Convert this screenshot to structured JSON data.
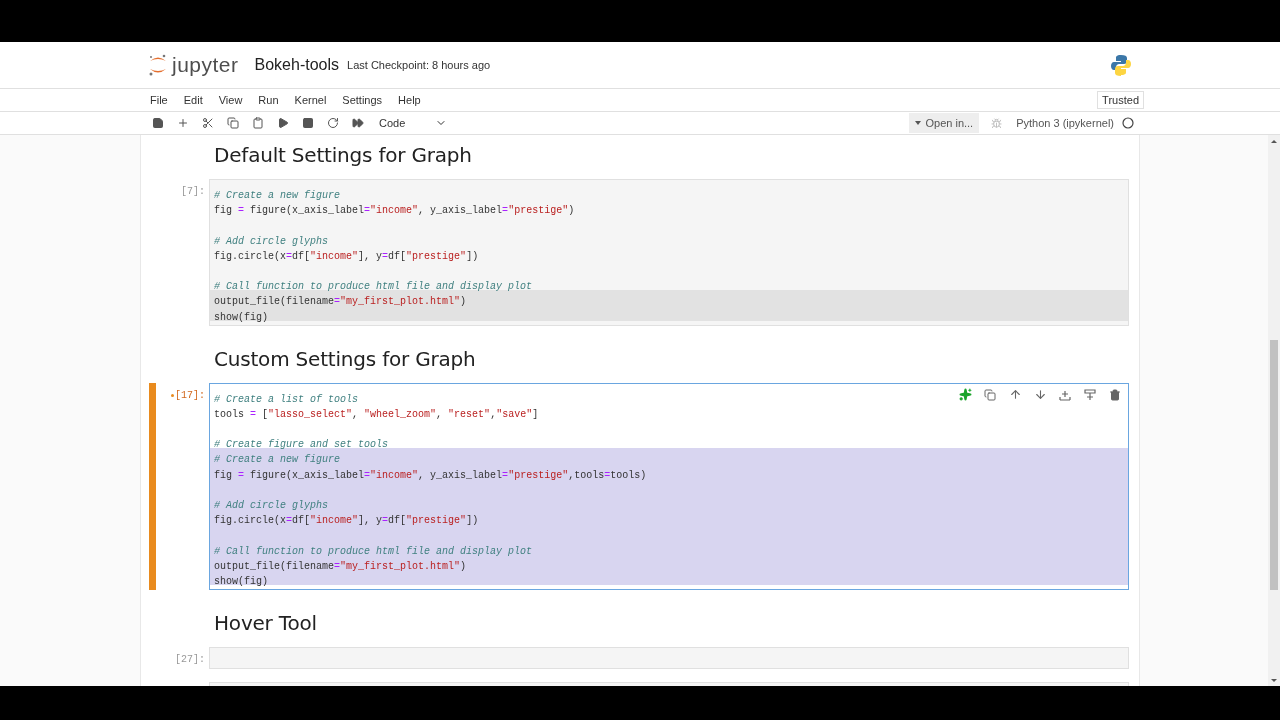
{
  "header": {
    "logo_text": "jupyter",
    "notebook_name": "Bokeh-tools",
    "checkpoint": "Last Checkpoint: 8 hours ago",
    "trusted": "Trusted"
  },
  "menu": [
    "File",
    "Edit",
    "View",
    "Run",
    "Kernel",
    "Settings",
    "Help"
  ],
  "toolbar": {
    "cell_type": "Code",
    "open_in": "Open in...",
    "kernel": "Python 3 (ipykernel)"
  },
  "cells": [
    {
      "kind": "markdown",
      "text": "Default Settings for Graph"
    },
    {
      "kind": "code",
      "prompt": "[7]:",
      "active": false,
      "modified": false,
      "blocks": [
        [
          {
            "text": "# Create a new figure",
            "selected": false
          },
          {
            "text": "fig = figure(x_axis_label=\"income\", y_axis_label=\"prestige\")",
            "selected": false
          }
        ],
        [
          {
            "text": "# Add circle glyphs",
            "selected": false
          },
          {
            "text": "fig.circle(x=df[\"income\"], y=df[\"prestige\"])",
            "selected": false
          }
        ],
        [
          {
            "text": "# Call function to produce html file and display plot",
            "selected": false
          },
          {
            "text": "output_file(filename=\"my_first_plot.html\")",
            "selected": true
          },
          {
            "text": "show(fig)",
            "selected": true
          }
        ]
      ]
    },
    {
      "kind": "markdown",
      "text": "Custom Settings for Graph"
    },
    {
      "kind": "code",
      "prompt": "[17]:",
      "active": true,
      "modified": true,
      "blocks": [
        [
          {
            "text": "# Create a list of tools",
            "selected": false
          },
          {
            "text": "tools = [\"lasso_select\", \"wheel_zoom\", \"reset\",\"save\"]",
            "selected": false
          }
        ],
        [
          {
            "text": "# Create figure and set tools",
            "selected": false
          },
          {
            "text": "# Create a new figure",
            "selected": true
          },
          {
            "text": "fig = figure(x_axis_label=\"income\", y_axis_label=\"prestige\",tools=tools)",
            "selected": true
          }
        ],
        [
          {
            "text": "# Add circle glyphs",
            "selected": true
          },
          {
            "text": "fig.circle(x=df[\"income\"], y=df[\"prestige\"])",
            "selected": true
          }
        ],
        [
          {
            "text": "# Call function to produce html file and display plot",
            "selected": true
          },
          {
            "text": "output_file(filename=\"my_first_plot.html\")",
            "selected": true
          },
          {
            "text": "show(fig)",
            "selected": true
          }
        ]
      ]
    },
    {
      "kind": "markdown",
      "text": "Hover Tool"
    },
    {
      "kind": "code",
      "prompt": "[27]:",
      "active": false,
      "modified": false
    },
    {
      "kind": "code"
    }
  ]
}
